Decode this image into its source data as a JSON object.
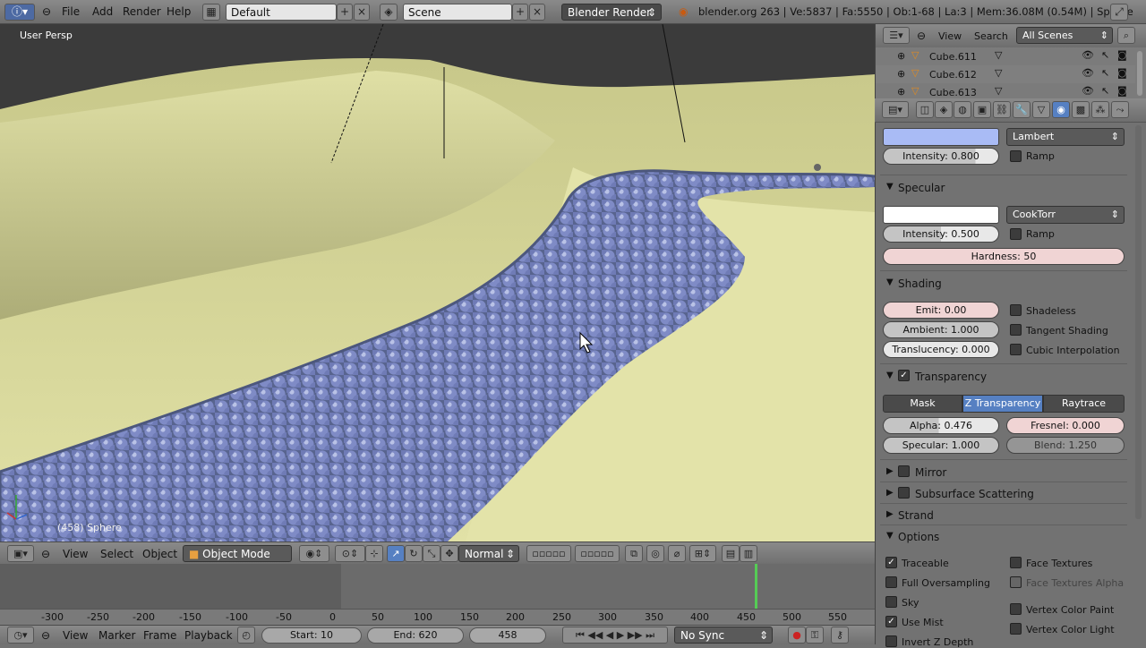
{
  "topbar": {
    "menus": [
      "File",
      "Add",
      "Render",
      "Help"
    ],
    "layout": "Default",
    "scene": "Scene",
    "engine": "Blender Render",
    "stats": "blender.org 263 | Ve:5837 | Fa:5550 | Ob:1-68 | La:3 | Mem:36.08M (0.54M) | Sphere"
  },
  "viewport": {
    "label": "User Persp",
    "object": "(458) Sphere"
  },
  "view3d_header": {
    "view": "View",
    "select": "Select",
    "object": "Object",
    "mode": "Object Mode",
    "orientation": "Normal"
  },
  "timeline": {
    "ticks": [
      "-300",
      "-250",
      "-200",
      "-150",
      "-100",
      "-50",
      "0",
      "50",
      "100",
      "150",
      "200",
      "250",
      "300",
      "350",
      "400",
      "450",
      "500",
      "550"
    ],
    "current_frame_marker": 458,
    "view": "View",
    "marker": "Marker",
    "frame": "Frame",
    "playback": "Playback",
    "start": "Start: 10",
    "end": "End: 620",
    "current": "458",
    "sync": "No Sync"
  },
  "outliner": {
    "view": "View",
    "search": "Search",
    "scenes": "All Scenes",
    "rows": [
      "Cube.611",
      "Cube.612",
      "Cube.613"
    ]
  },
  "properties": {
    "diffuse": {
      "color": "#a9bbf5",
      "shader": "Lambert",
      "intensity": "Intensity: 0.800",
      "ramp": "Ramp"
    },
    "specular": {
      "title": "Specular",
      "color": "#ffffff",
      "shader": "CookTorr",
      "intensity": "Intensity: 0.500",
      "ramp": "Ramp",
      "hardness": "Hardness: 50"
    },
    "shading": {
      "title": "Shading",
      "emit": "Emit: 0.00",
      "ambient": "Ambient: 1.000",
      "translucency": "Translucency: 0.000",
      "shadeless": "Shadeless",
      "tangent": "Tangent Shading",
      "cubic": "Cubic Interpolation"
    },
    "transparency": {
      "title": "Transparency",
      "tabs": [
        "Mask",
        "Z Transparency",
        "Raytrace"
      ],
      "active_tab": "Z Transparency",
      "alpha": "Alpha: 0.476",
      "fresnel": "Fresnel: 0.000",
      "specular": "Specular: 1.000",
      "blend": "Blend: 1.250"
    },
    "mirror": "Mirror",
    "sss": "Subsurface Scattering",
    "strand": "Strand",
    "options": {
      "title": "Options",
      "traceable": "Traceable",
      "full_oversampling": "Full Oversampling",
      "sky": "Sky",
      "use_mist": "Use Mist",
      "invert_z": "Invert Z Depth",
      "face_textures": "Face Textures",
      "face_textures_alpha": "Face Textures Alpha",
      "vertex_color_paint": "Vertex Color Paint",
      "vertex_color_light": "Vertex Color Light"
    }
  },
  "colors": {
    "accent": "#5680c2",
    "beads": "#7a87c4",
    "floor": "#d9d99a"
  }
}
